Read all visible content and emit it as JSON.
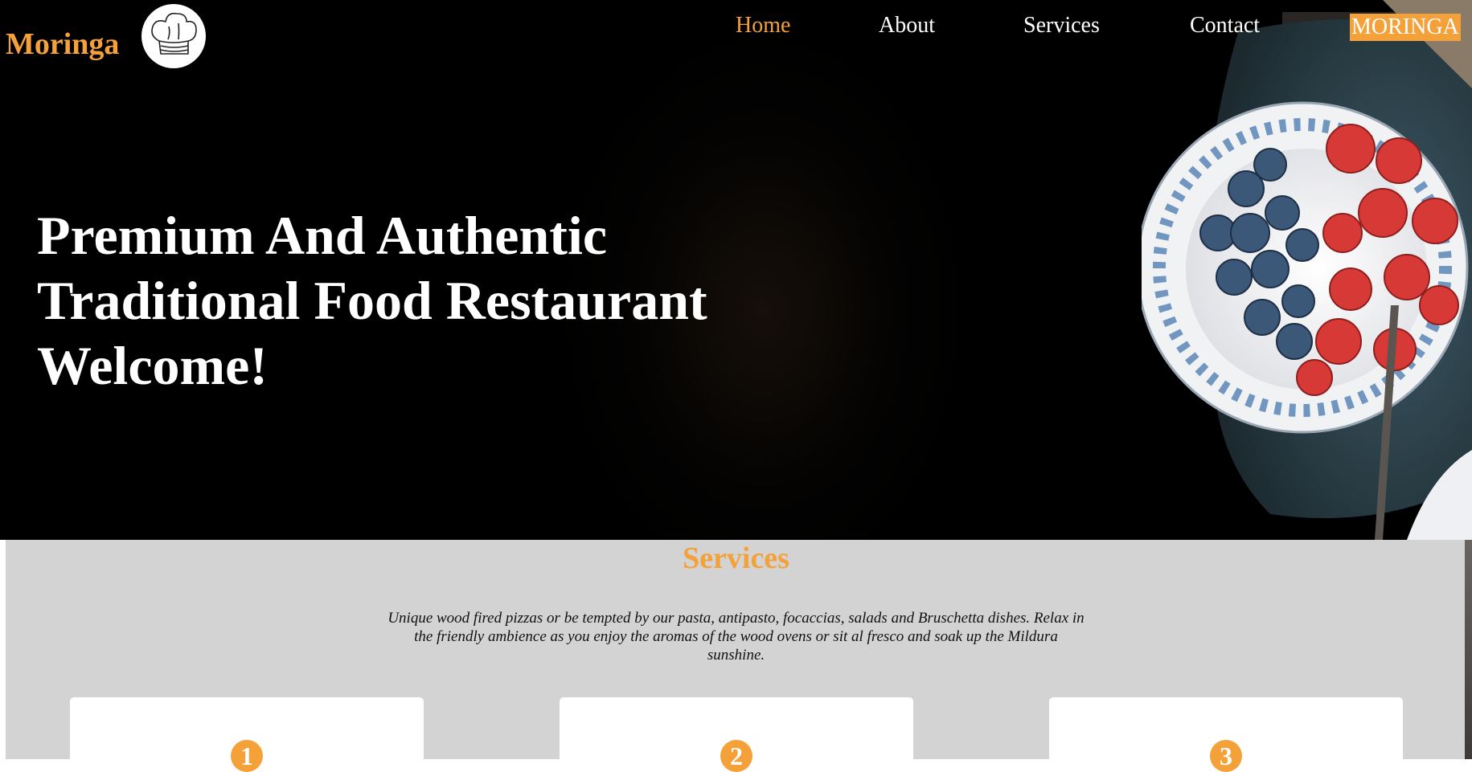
{
  "header": {
    "logo_text": "Moringa",
    "nav": [
      {
        "label": "Home",
        "active": true
      },
      {
        "label": "About",
        "active": false
      },
      {
        "label": "Services",
        "active": false
      },
      {
        "label": "Contact",
        "active": false
      }
    ],
    "brand_badge": "MORINGA"
  },
  "hero": {
    "headline_lines": [
      "Premium And Authentic",
      "Traditional Food Restaurant",
      "Welcome!"
    ]
  },
  "services": {
    "title": "Services",
    "description": "Unique wood fired pizzas or be tempted by our pasta, antipasto, focaccias, salads and Bruschetta dishes. Relax in the friendly ambience as you enjoy the aromas of the wood ovens or sit al fresco and soak up the Mildura sunshine.",
    "cards": [
      {
        "number": "1"
      },
      {
        "number": "2"
      },
      {
        "number": "3"
      }
    ]
  },
  "colors": {
    "accent": "#f5a13a",
    "hero_bg": "#000000",
    "services_bg": "#d3d3d3"
  },
  "icons": {
    "logo": "chef-hat-icon"
  }
}
